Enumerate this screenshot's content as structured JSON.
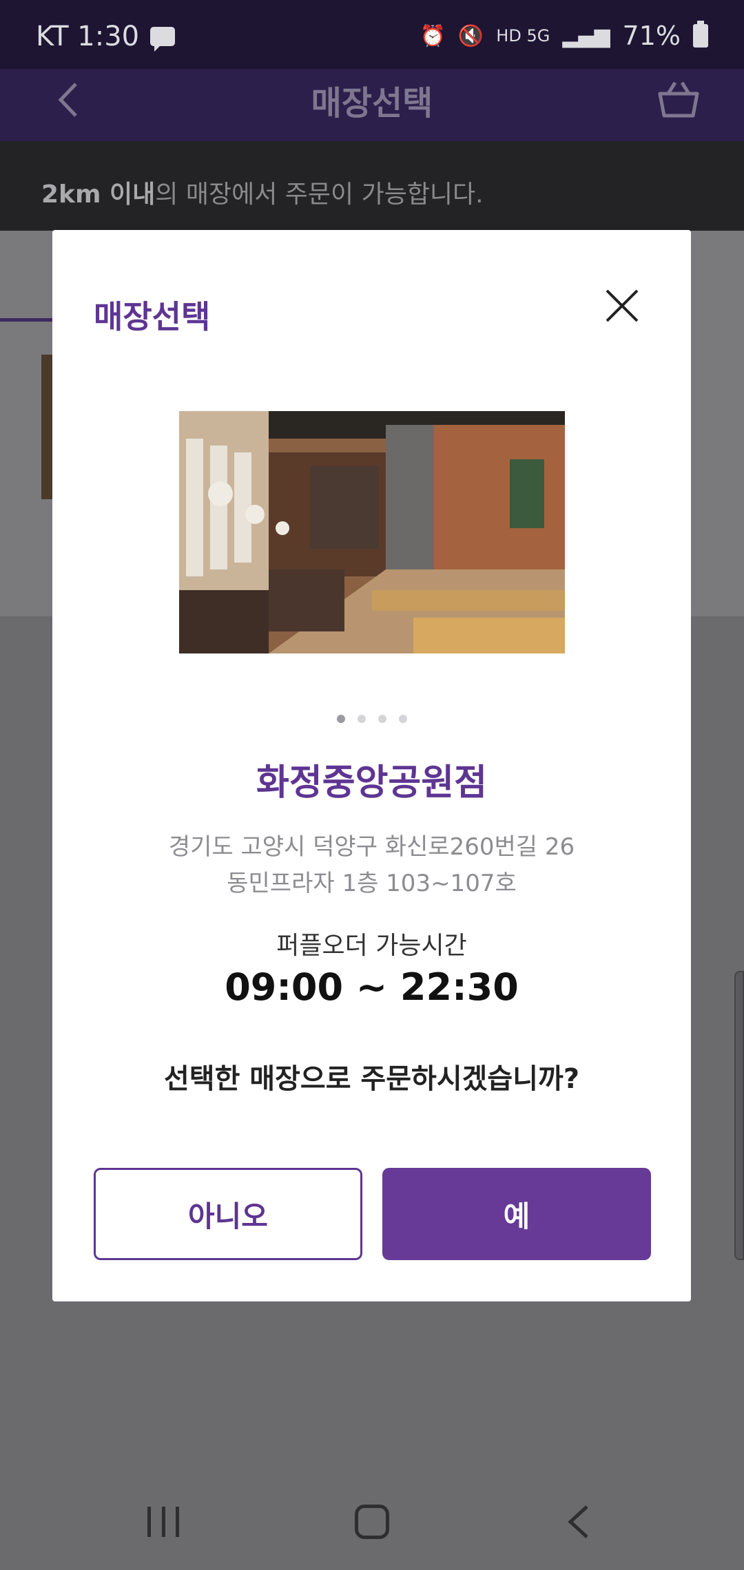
{
  "status_bar": {
    "carrier_time": "KT 1:30",
    "indicators": "HD  5G",
    "battery": "71%",
    "icons": [
      "message-icon",
      "alarm-icon",
      "mute-icon",
      "signal-icon",
      "battery-icon"
    ]
  },
  "app_bar": {
    "title": "매장선택",
    "icons": [
      "back-icon",
      "cart-icon"
    ]
  },
  "notice": {
    "bold": "2km 이내",
    "rest": "의 매장에서 주문이 가능합니다."
  },
  "modal": {
    "title": "매장선택",
    "carousel": {
      "pages": 4,
      "active": 1
    },
    "store_name": "화정중앙공원점",
    "address_line1": "경기도 고양시 덕양구 화신로260번길 26",
    "address_line2": "동민프라자 1층 103~107호",
    "hours_label": "퍼플오더 가능시간",
    "hours_value": "09:00 ~ 22:30",
    "question": "선택한 매장으로 주문하시겠습니까?",
    "no_label": "아니오",
    "yes_label": "예"
  },
  "colors": {
    "brand_purple": "#663a96",
    "title_purple": "#5e3592",
    "overlay_bg": "#6b6b6e"
  }
}
